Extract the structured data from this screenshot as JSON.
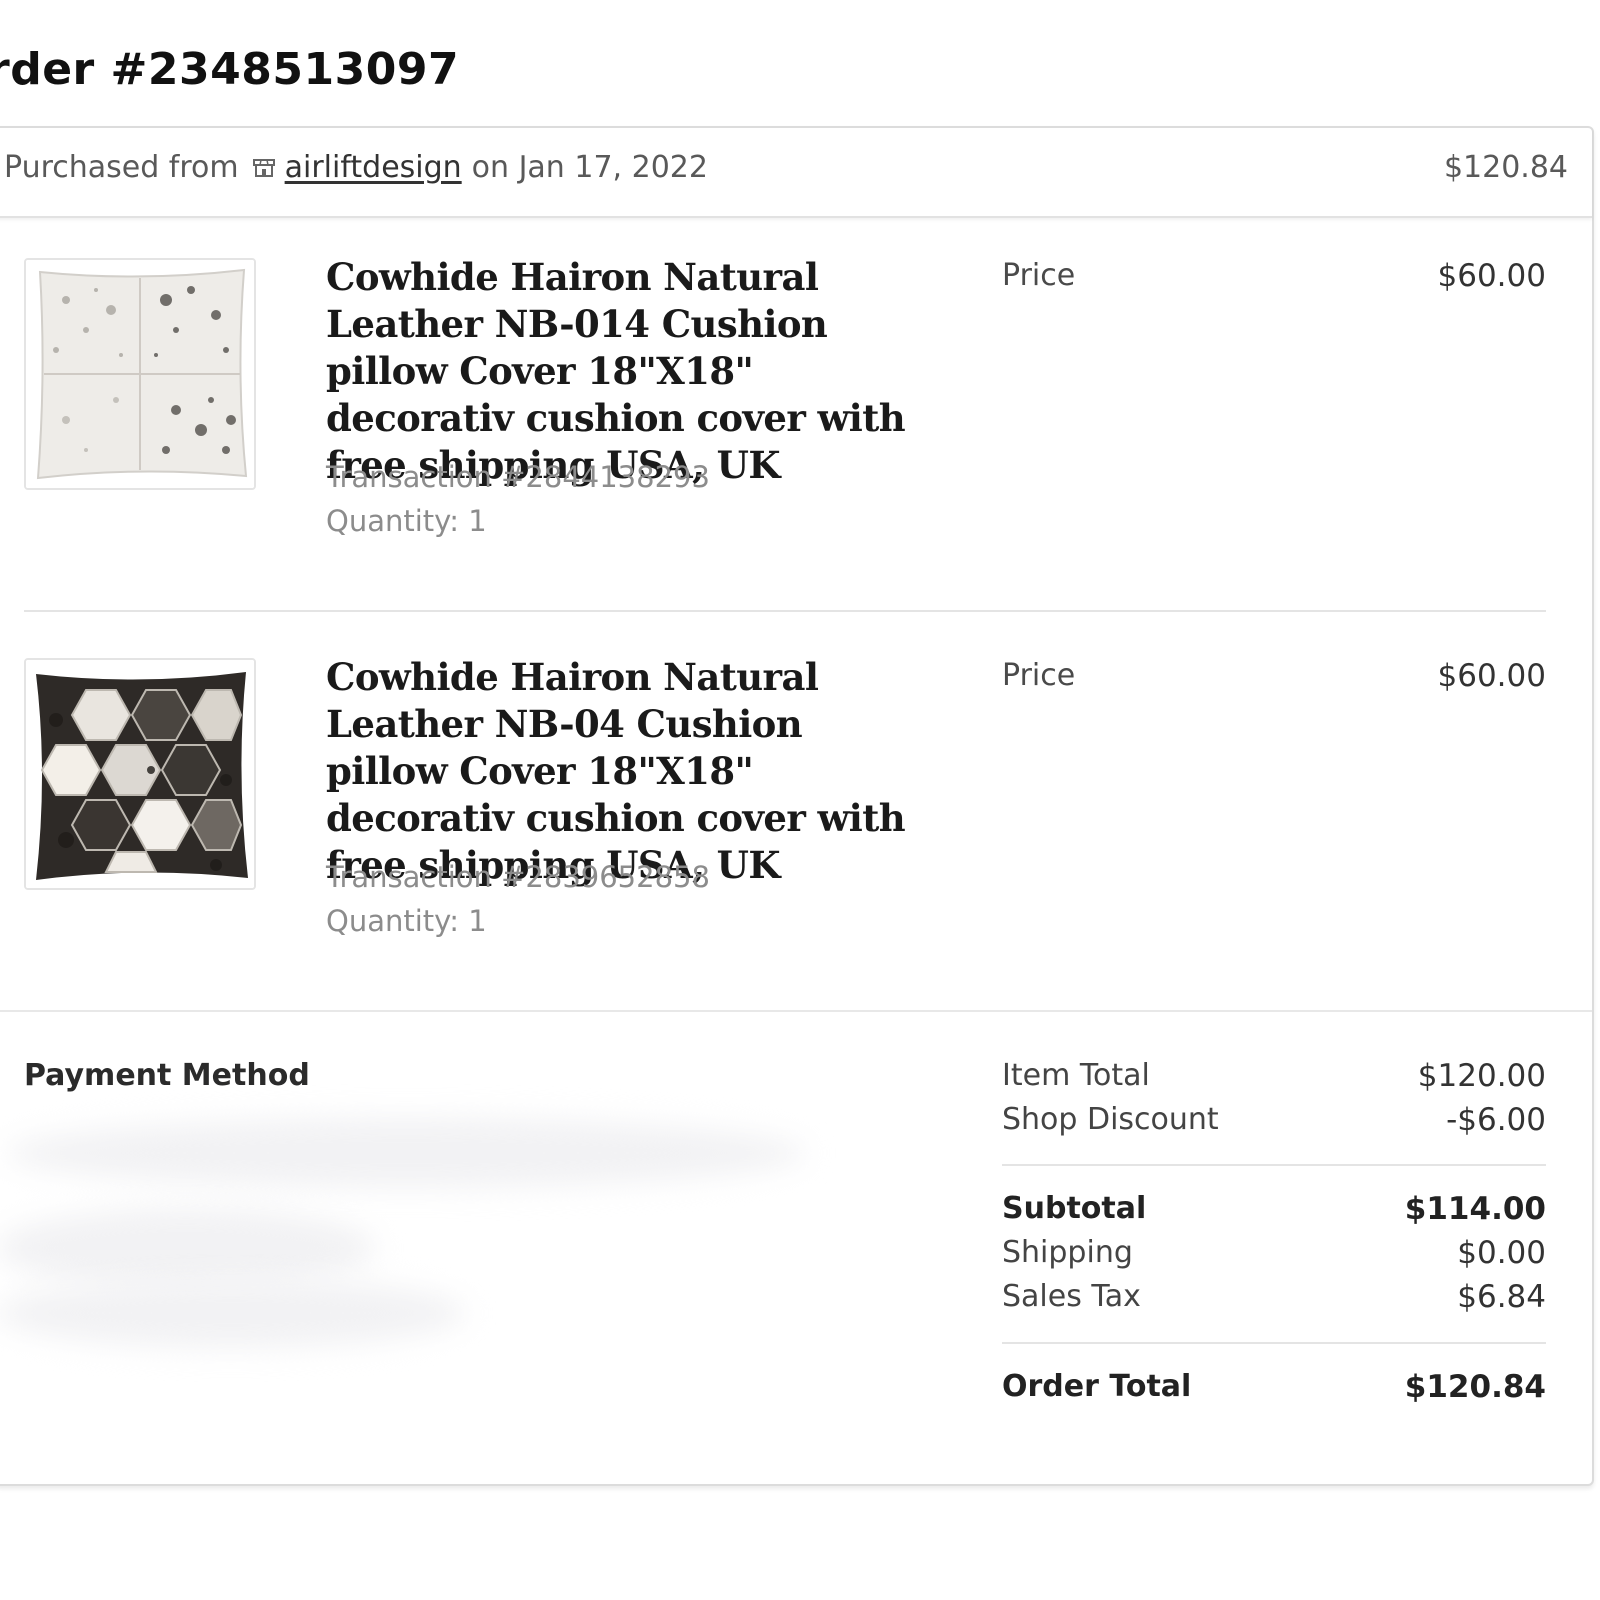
{
  "order": {
    "title": "rder #2348513097"
  },
  "header": {
    "purchased_from": "Purchased from",
    "shop_name": "airliftdesign",
    "date_text": "on Jan 17, 2022",
    "total": "$120.84",
    "shop_icon": "shop-icon"
  },
  "items": [
    {
      "title": "Cowhide Hairon Natural Leather NB-014 Cushion pillow Cover 18\"X18\" decorativ cushion cover with free shipping USA, UK",
      "transaction": "Transaction #2844138293",
      "quantity": "Quantity: 1",
      "price_label": "Price",
      "price": "$60.00"
    },
    {
      "title": "Cowhide Hairon Natural Leather NB-04 Cushion pillow Cover 18\"X18\" decorativ cushion cover with free shipping USA, UK",
      "transaction": "Transaction #2839652858",
      "quantity": "Quantity: 1",
      "price_label": "Price",
      "price": "$60.00"
    }
  ],
  "payment": {
    "label": "Payment Method"
  },
  "summary": {
    "item_total_label": "Item Total",
    "item_total": "$120.00",
    "discount_label": "Shop Discount",
    "discount": "-$6.00",
    "subtotal_label": "Subtotal",
    "subtotal": "$114.00",
    "shipping_label": "Shipping",
    "shipping": "$0.00",
    "tax_label": "Sales Tax",
    "tax": "$6.84",
    "order_total_label": "Order Total",
    "order_total": "$120.84"
  }
}
